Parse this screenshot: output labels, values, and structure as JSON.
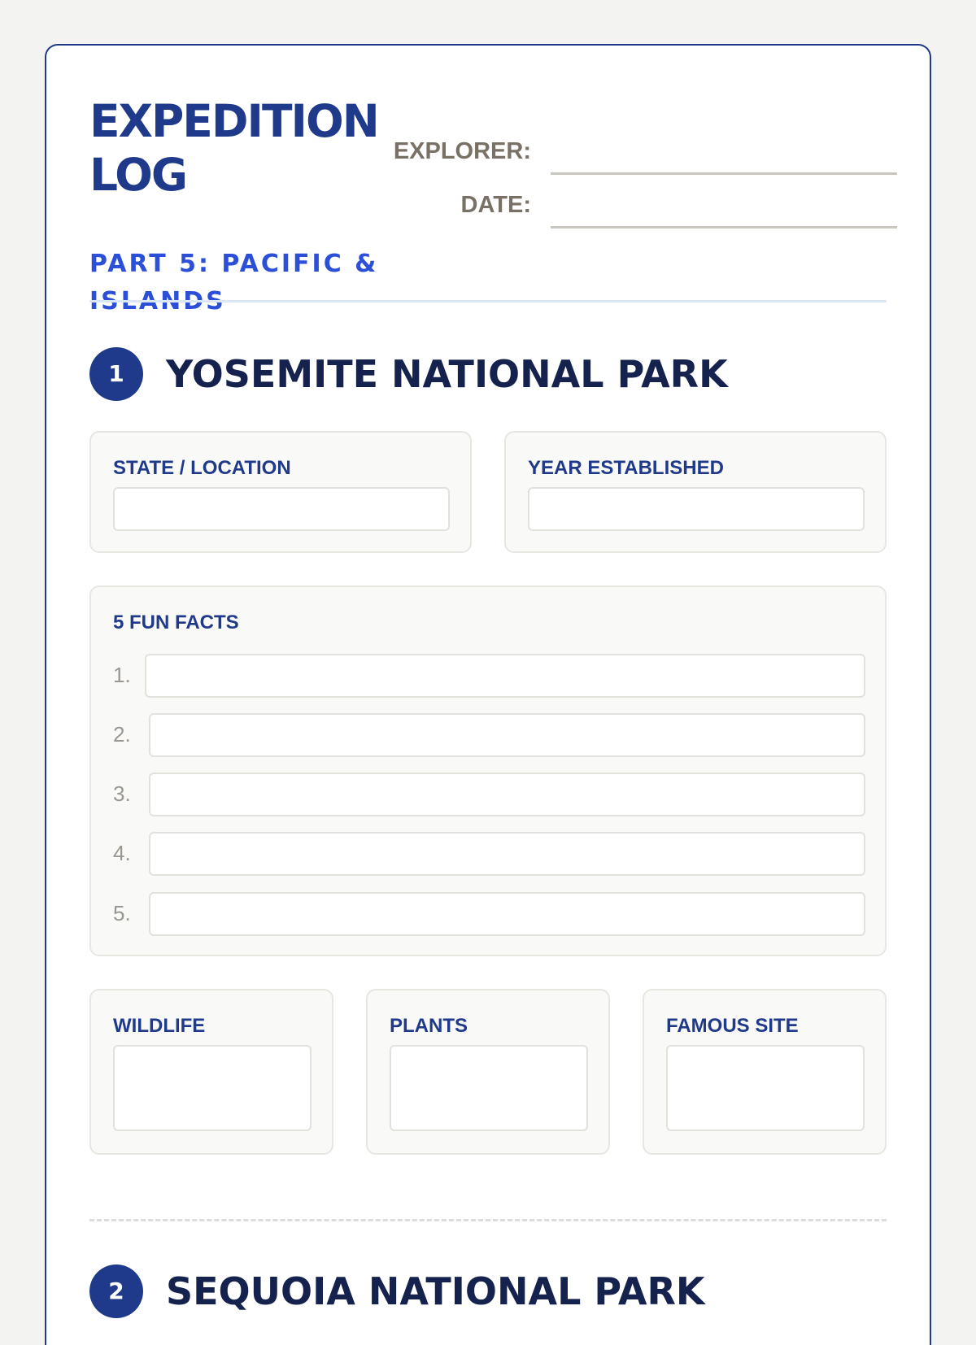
{
  "header": {
    "title": "EXPEDITION LOG",
    "subtitle": "PART 5: PACIFIC & ISLANDS",
    "explorer_label": "EXPLORER:",
    "date_label": "DATE:"
  },
  "parks": [
    {
      "number": "1",
      "name": "YOSEMITE NATIONAL PARK",
      "state_label": "STATE / LOCATION",
      "year_label": "YEAR ESTABLISHED",
      "facts_label": "5 FUN FACTS",
      "fact_numbers": [
        "1.",
        "2.",
        "3.",
        "4.",
        "5."
      ],
      "wildlife_label": "WILDLIFE",
      "plants_label": "PLANTS",
      "famous_site_label": "FAMOUS SITE"
    },
    {
      "number": "2",
      "name": "SEQUOIA NATIONAL PARK"
    }
  ],
  "colors": {
    "primary": "#1f3a8a",
    "accent": "#2b4fd8",
    "muted": "#7a7166"
  }
}
